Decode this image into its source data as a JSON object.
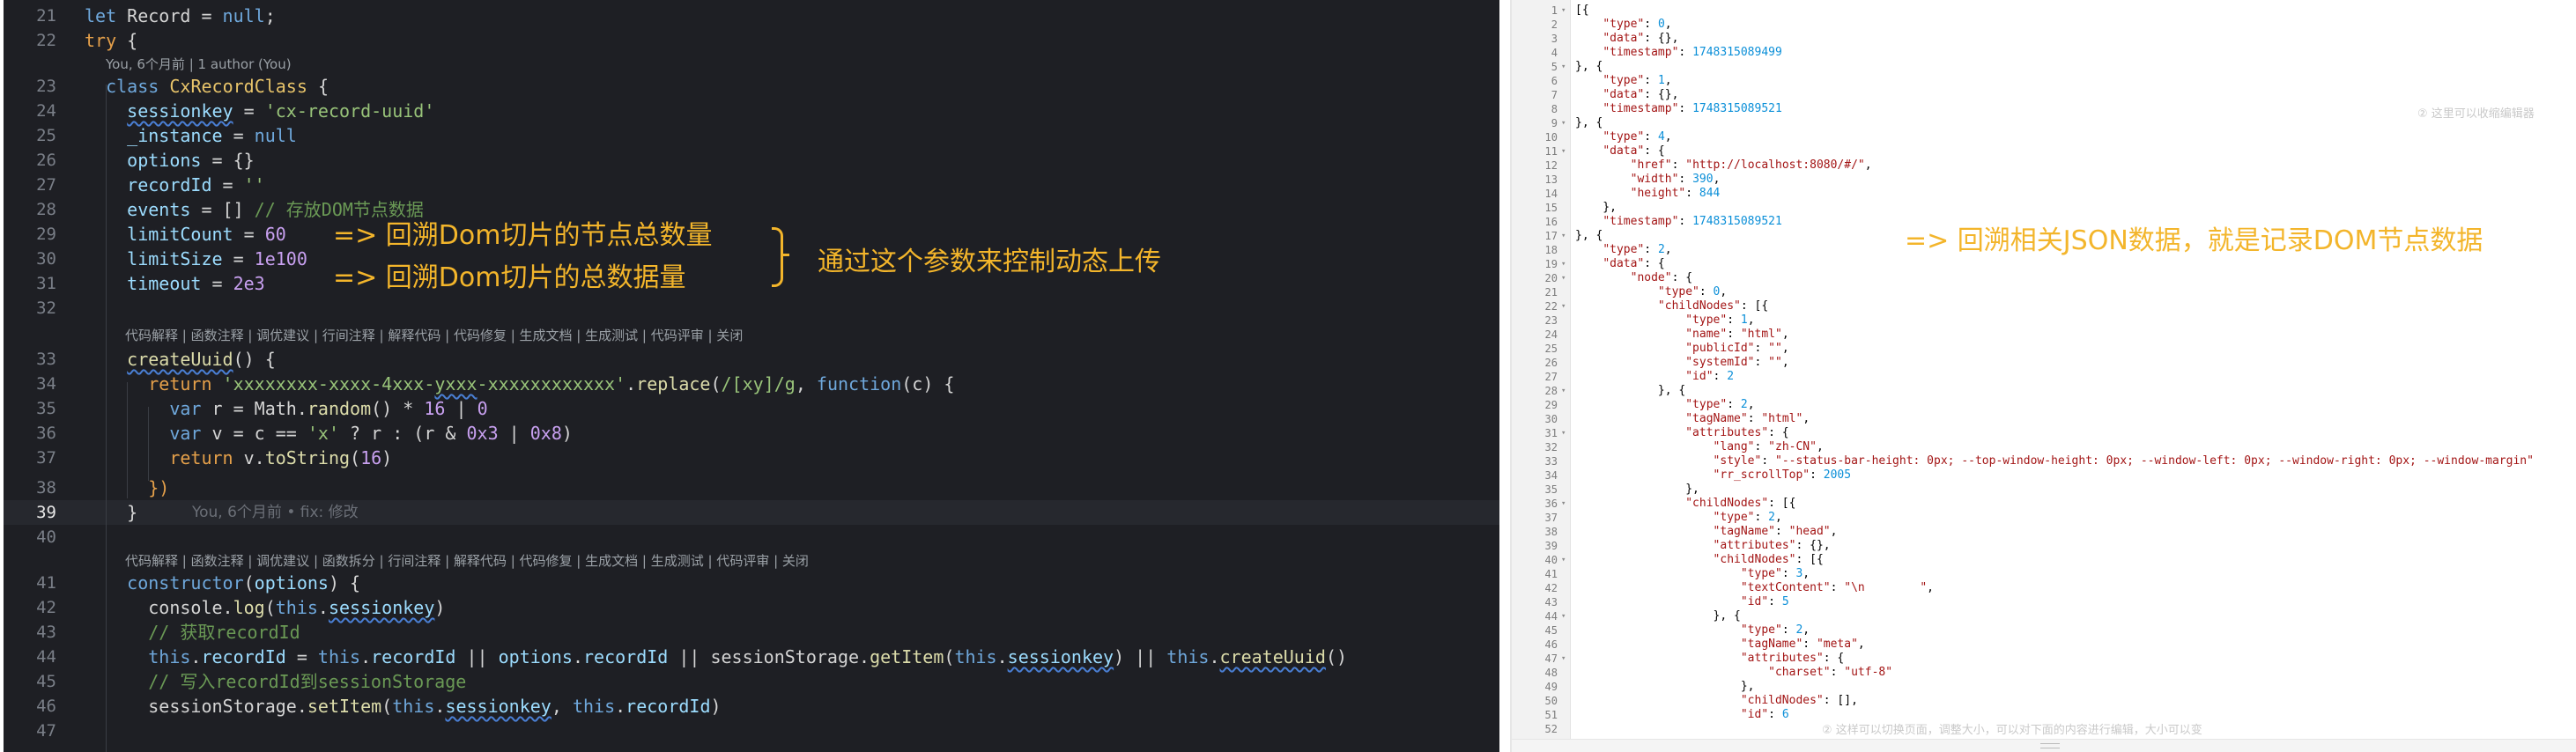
{
  "editor": {
    "blame_inline": "You, 6个月前 | 1 author (You)",
    "codelens_1": "代码解释 | 函数注释 | 调优建议 | 行间注释 | 解释代码 | 代码修复 | 生成文档 | 生成测试 | 代码评审 | 关闭",
    "codelens_2": "代码解释 | 函数注释 | 调优建议 | 函数拆分 | 行间注释 | 解释代码 | 代码修复 | 生成文档 | 生成测试 | 代码评审 | 关闭",
    "ghost_blame": "You, 6个月前 • fix: 修改",
    "line_numbers": [
      "21",
      "22",
      "23",
      "24",
      "25",
      "26",
      "27",
      "28",
      "29",
      "30",
      "31",
      "32",
      "33",
      "34",
      "35",
      "36",
      "37",
      "38",
      "39",
      "40",
      "41",
      "42",
      "43",
      "44",
      "45",
      "46",
      "47"
    ],
    "active_line": "39"
  },
  "annotations": {
    "limit_count": "=> 回溯Dom切片的节点总数量",
    "limit_size": "=> 回溯Dom切片的总数据量",
    "param_note": "通过这个参数来控制动态上传",
    "json_note": "=> 回溯相关JSON数据，就是记录DOM节点数据"
  },
  "viewer": {
    "hint_top": "② 这里可以收缩编辑器",
    "hint_bottom": "② 这样可以切换页面，调整大小，可以对下面的内容进行编辑，大小可以变",
    "line_numbers": [
      "1",
      "2",
      "3",
      "4",
      "5",
      "6",
      "7",
      "8",
      "9",
      "10",
      "11",
      "12",
      "13",
      "14",
      "15",
      "16",
      "17",
      "18",
      "19",
      "20",
      "21",
      "22",
      "23",
      "24",
      "25",
      "26",
      "27",
      "28",
      "29",
      "30",
      "31",
      "32",
      "33",
      "34",
      "35",
      "36",
      "37",
      "38",
      "39",
      "40",
      "41",
      "42",
      "43",
      "44",
      "45",
      "46",
      "47",
      "48",
      "49",
      "50",
      "51",
      "52"
    ]
  },
  "colors": {
    "accent": "#f3b52b",
    "editor_bg": "#1e1f24"
  }
}
